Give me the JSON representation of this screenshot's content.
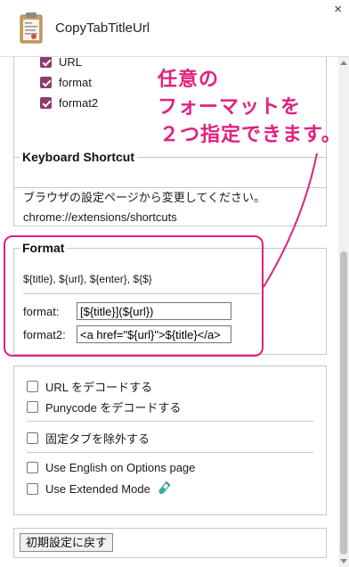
{
  "window": {
    "title": "CopyTabTitleUrl",
    "close_glyph": "×"
  },
  "top_section": {
    "items": [
      {
        "label": "URL",
        "checked": true
      },
      {
        "label": "format",
        "checked": true
      },
      {
        "label": "format2",
        "checked": true
      }
    ]
  },
  "shortcut": {
    "legend": "Keyboard Shortcut",
    "description": "ブラウザの設定ページから変更してください。",
    "url": "chrome://extensions/shortcuts"
  },
  "format": {
    "legend": "Format",
    "placeholders": "${title}, ${url}, ${enter}, ${$}",
    "format_label": "format:",
    "format_value": "[${title}](${url})",
    "format2_label": "format2:",
    "format2_value": "<a href=\"${url}\">${title}</a>"
  },
  "options": {
    "decode_url": {
      "label": "URL をデコードする",
      "checked": false
    },
    "decode_punycode": {
      "label": "Punycode をデコードする",
      "checked": false
    },
    "exclude_pinned": {
      "label": "固定タブを除外する",
      "checked": false
    },
    "use_english": {
      "label": "Use English on Options page",
      "checked": false
    },
    "extended_mode": {
      "label": "Use Extended Mode",
      "checked": false,
      "icon": "test-tube-icon"
    }
  },
  "reset": {
    "label": "初期設定に戻す"
  },
  "annotation": {
    "lines": [
      "任意の",
      "フォーマットを",
      "２つ指定できます。"
    ],
    "color": "#e0217f"
  },
  "colors": {
    "accent": "#e0217f",
    "checkbox_checked": "#8d3c6c"
  }
}
